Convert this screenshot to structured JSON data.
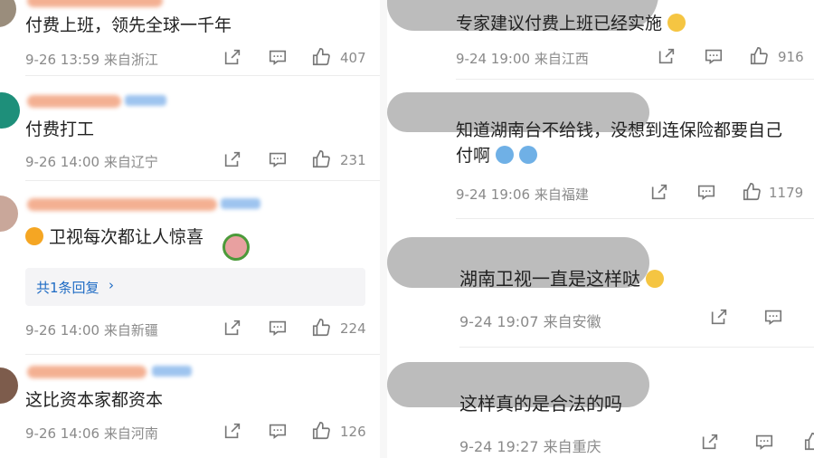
{
  "left": [
    {
      "text": "付费上班，领先全球一千年",
      "date": "9-26 13:59",
      "loc": "来自浙江",
      "likes": "407"
    },
    {
      "text": "付费打工",
      "date": "9-26 14:00",
      "loc": "来自辽宁",
      "likes": "231"
    },
    {
      "text": "卫视每次都让人惊喜",
      "date": "9-26 14:00",
      "loc": "来自新疆",
      "likes": "224",
      "reply": "共1条回复"
    },
    {
      "text": "这比资本家都资本",
      "date": "9-26 14:06",
      "loc": "来自河南",
      "likes": "126"
    }
  ],
  "right": [
    {
      "text": "专家建议付费上班已经实施",
      "date": "9-24 19:00",
      "loc": "来自江西",
      "likes": "916"
    },
    {
      "text1": "知道湖南台不给钱，没想到连保险都要自己",
      "text2": "付啊",
      "date": "9-24 19:06",
      "loc": "来自福建",
      "likes": "1179"
    },
    {
      "text": "湖南卫视一直是这样哒",
      "date": "9-24 19:07",
      "loc": "来自安徽"
    },
    {
      "text": "这样真的是合法的吗",
      "date": "9-24 19:27",
      "loc": "来自重庆"
    }
  ],
  "icons": [
    "share-icon",
    "comment-icon",
    "like-icon"
  ],
  "colors": {
    "link": "#1e6bc4",
    "meta": "#8a8a8a",
    "text": "#222222"
  }
}
